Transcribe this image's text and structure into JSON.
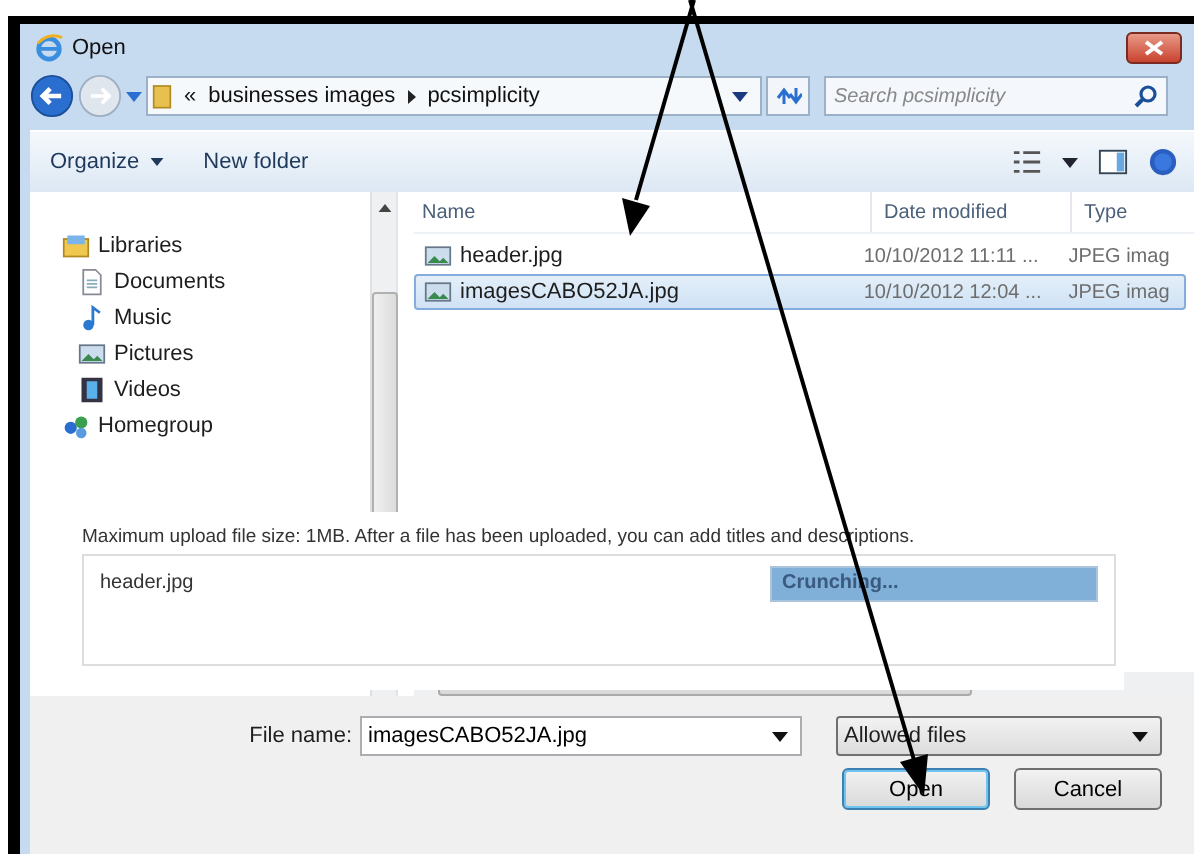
{
  "window": {
    "title": "Open"
  },
  "address": {
    "overflow": "«",
    "crumbs": [
      "businesses images",
      "pcsimplicity"
    ]
  },
  "search": {
    "placeholder": "Search pcsimplicity"
  },
  "toolbar": [
    {
      "label": "Organize",
      "kind": "menu"
    },
    {
      "label": "New folder",
      "kind": "plain"
    }
  ],
  "navigation": [
    {
      "label": "Libraries",
      "kind": "libraries",
      "children": [
        {
          "label": "Documents",
          "kind": "documents"
        },
        {
          "label": "Music",
          "kind": "music"
        },
        {
          "label": "Pictures",
          "kind": "pictures"
        },
        {
          "label": "Videos",
          "kind": "videos"
        }
      ]
    },
    {
      "label": "Homegroup",
      "kind": "homegroup"
    }
  ],
  "file_list": {
    "columns": [
      "Name",
      "Date modified",
      "Type"
    ],
    "rows": [
      {
        "name": "header.jpg",
        "date": "10/10/2012 11:11 ...",
        "type": "JPEG imag",
        "selected": false
      },
      {
        "name": "imagesCABO52JA.jpg",
        "date": "10/10/2012 12:04 ...",
        "type": "JPEG imag",
        "selected": true
      }
    ]
  },
  "upload": {
    "notice": "Maximum upload file size: 1MB. After a file has been uploaded, you can add titles and descriptions.",
    "items": [
      {
        "name": "header.jpg",
        "status": "Crunching...",
        "level": 1
      }
    ]
  },
  "file_name": {
    "label": "File name:",
    "value": "imagesCABO52JA.jpg"
  },
  "file_type": {
    "value": "Allowed files"
  },
  "buttons": [
    {
      "label": "Open",
      "default": true
    },
    {
      "label": "Cancel",
      "default": false
    }
  ]
}
